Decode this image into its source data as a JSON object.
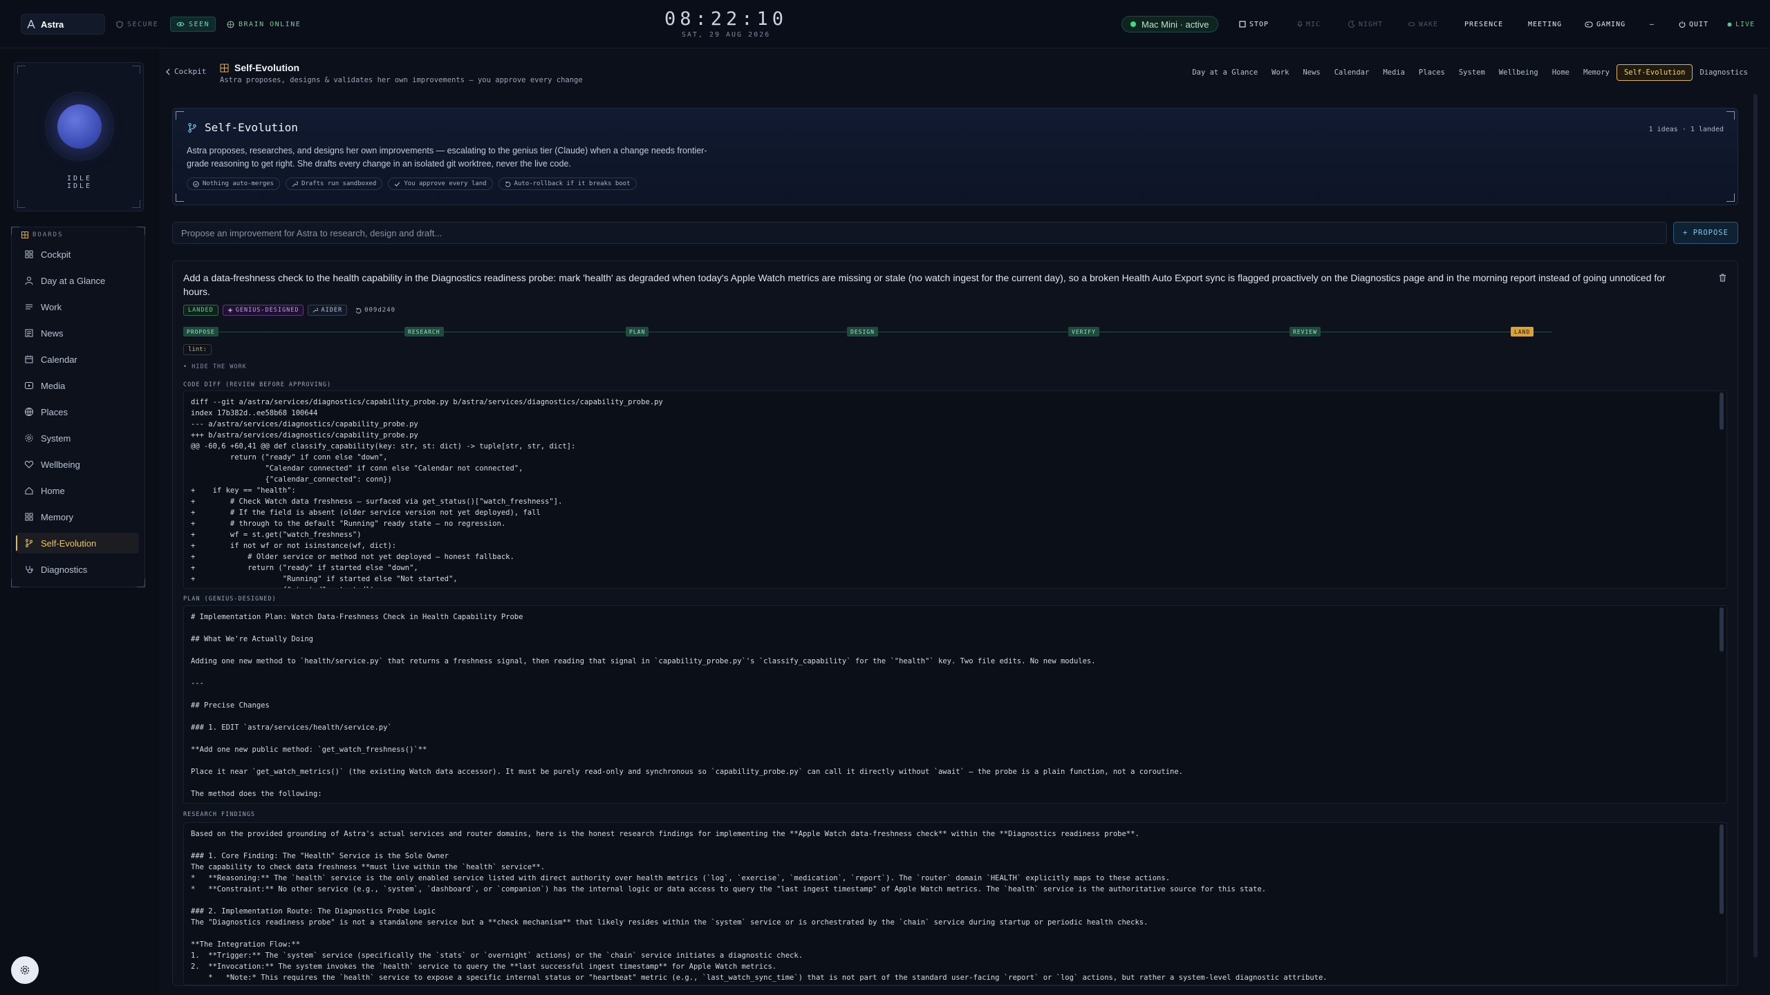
{
  "topbar": {
    "app_name": "Astra",
    "indicators": [
      {
        "label": "SECURE",
        "icon": "shield-icon",
        "state": "dim"
      },
      {
        "label": "SEEN",
        "icon": "eye-icon",
        "state": "on"
      },
      {
        "label": "BRAIN ONLINE",
        "icon": "brain-icon",
        "state": "green"
      }
    ],
    "clock": "08:22:10",
    "date": "SAT, 29 AUG 2026",
    "device": "Mac Mini · active",
    "buttons": {
      "stop": "STOP",
      "mic": "MIC",
      "night": "NIGHT",
      "wake": "WAKE",
      "presence": "PRESENCE",
      "meeting": "MEETING",
      "gaming": "GAMING",
      "minimize": "—",
      "quit": "QUIT",
      "live": "LIVE"
    }
  },
  "rail": {
    "state_label": "IDLE",
    "state_label_2": "IDLE",
    "boards_header": "BOARDS",
    "items": [
      {
        "label": "Cockpit",
        "icon": "grid-icon"
      },
      {
        "label": "Day at a Glance",
        "icon": "person-icon"
      },
      {
        "label": "Work",
        "icon": "list-icon"
      },
      {
        "label": "News",
        "icon": "newspaper-icon"
      },
      {
        "label": "Calendar",
        "icon": "calendar-icon"
      },
      {
        "label": "Media",
        "icon": "play-icon"
      },
      {
        "label": "Places",
        "icon": "globe-icon"
      },
      {
        "label": "System",
        "icon": "gear-icon"
      },
      {
        "label": "Wellbeing",
        "icon": "heart-icon"
      },
      {
        "label": "Home",
        "icon": "home-icon"
      },
      {
        "label": "Memory",
        "icon": "memory-icon"
      },
      {
        "label": "Self-Evolution",
        "icon": "branch-icon",
        "active": true
      },
      {
        "label": "Diagnostics",
        "icon": "stethoscope-icon"
      }
    ]
  },
  "header": {
    "back_label": "Cockpit",
    "title": "Self-Evolution",
    "subtitle": "Astra proposes, designs & validates her own improvements — you approve every change",
    "tabs": [
      "Day at a Glance",
      "Work",
      "News",
      "Calendar",
      "Media",
      "Places",
      "System",
      "Wellbeing",
      "Home",
      "Memory",
      "Self-Evolution",
      "Diagnostics"
    ],
    "active_tab": "Self-Evolution"
  },
  "intro": {
    "title": "Self-Evolution",
    "count": "1 ideas · 1 landed",
    "description": "Astra proposes, researches, and designs her own improvements — escalating to the genius tier (Claude) when a change needs frontier-grade reasoning to get right. She drafts every change in an isolated git worktree, never the live code.",
    "chips": [
      {
        "label": "Nothing auto-merges",
        "icon": "circle-check-icon"
      },
      {
        "label": "Drafts run sandboxed",
        "icon": "wrench-icon"
      },
      {
        "label": "You approve every land",
        "icon": "check-icon"
      },
      {
        "label": "Auto-rollback if it breaks boot",
        "icon": "rollback-icon"
      }
    ]
  },
  "propose": {
    "placeholder": "Propose an improvement for Astra to research, design and draft...",
    "button": "+ PROPOSE"
  },
  "idea": {
    "text": "Add a data-freshness check to the health capability in the Diagnostics readiness probe: mark 'health' as degraded when today's Apple Watch metrics are missing or stale (no watch ingest for the current day), so a broken Health Auto Export sync is flagged proactively on the Diagnostics page and in the morning report instead of going unnoticed for hours.",
    "tags": {
      "status": "LANDED",
      "designer": "GENIUS-DESIGNED",
      "tool": "AIDER",
      "commit": "009d240"
    },
    "stages": [
      "PROPOSE",
      "RESEARCH",
      "PLAN",
      "DESIGN",
      "VERIFY",
      "REVIEW",
      "LAND"
    ],
    "lint": "lint:",
    "hide_work": "• HIDE THE WORK",
    "diff_label": "CODE DIFF (REVIEW BEFORE APPROVING)",
    "diff": "diff --git a/astra/services/diagnostics/capability_probe.py b/astra/services/diagnostics/capability_probe.py\nindex 17b382d..ee58b68 100644\n--- a/astra/services/diagnostics/capability_probe.py\n+++ b/astra/services/diagnostics/capability_probe.py\n@@ -60,6 +60,41 @@ def classify_capability(key: str, st: dict) -> tuple[str, str, dict]:\n         return (\"ready\" if conn else \"down\",\n                 \"Calendar connected\" if conn else \"Calendar not connected\",\n                 {\"calendar_connected\": conn})\n+    if key == \"health\":\n+        # Check Watch data freshness — surfaced via get_status()[\"watch_freshness\"].\n+        # If the field is absent (older service version not yet deployed), fall\n+        # through to the default \"Running\" ready state — no regression.\n+        wf = st.get(\"watch_freshness\")\n+        if not wf or not isinstance(wf, dict):\n+            # Older service or method not yet deployed — honest fallback.\n+            return (\"ready\" if started else \"down\",\n+                    \"Running\" if started else \"Not started\",\n+                    {\"started\": started})",
    "plan_label": "PLAN (GENIUS-DESIGNED)",
    "plan": "# Implementation Plan: Watch Data-Freshness Check in Health Capability Probe\n\n## What We're Actually Doing\n\nAdding one new method to `health/service.py` that returns a freshness signal, then reading that signal in `capability_probe.py`'s `classify_capability` for the `\"health\"` key. Two file edits. No new modules.\n\n---\n\n## Precise Changes\n\n### 1. EDIT `astra/services/health/service.py`\n\n**Add one new public method: `get_watch_freshness()`**\n\nPlace it near `get_watch_metrics()` (the existing Watch data accessor). It must be purely read-only and synchronous so `capability_probe.py` can call it directly without `await` — the probe is a plain function, not a coroutine.\n\nThe method does the following:",
    "research_label": "RESEARCH FINDINGS",
    "research": "Based on the provided grounding of Astra's actual services and router domains, here is the honest research findings for implementing the **Apple Watch data-freshness check** within the **Diagnostics readiness probe**.\n\n### 1. Core Finding: The \"Health\" Service is the Sole Owner\nThe capability to check data freshness **must live within the `health` service**.\n*   **Reasoning:** The `health` service is the only enabled service listed with direct authority over health metrics (`log`, `exercise`, `medication`, `report`). The `router` domain `HEALTH` explicitly maps to these actions.\n*   **Constraint:** No other service (e.g., `system`, `dashboard`, or `companion`) has the internal logic or data access to query the \"last ingest timestamp\" of Apple Watch metrics. The `health` service is the authoritative source for this state.\n\n### 2. Implementation Route: The Diagnostics Probe Logic\nThe \"Diagnostics readiness probe\" is not a standalone service but a **check mechanism** that likely resides within the `system` service or is orchestrated by the `chain` service during startup or periodic health checks.\n\n**The Integration Flow:**\n1.  **Trigger:** The `system` service (specifically the `stats` or `overnight` actions) or the `chain` service initiates a diagnostic check.\n2.  **Invocation:** The system invokes the `health` service to query the **last successful ingest timestamp** for Apple Watch metrics.\n    *   *Note:* This requires the `health` service to expose a specific internal status or \"heartbeat\" metric (e.g., `last_watch_sync_time`) that is not part of the standard user-facing `report` or `log` actions, but rather a system-level diagnostic attribute."
  }
}
